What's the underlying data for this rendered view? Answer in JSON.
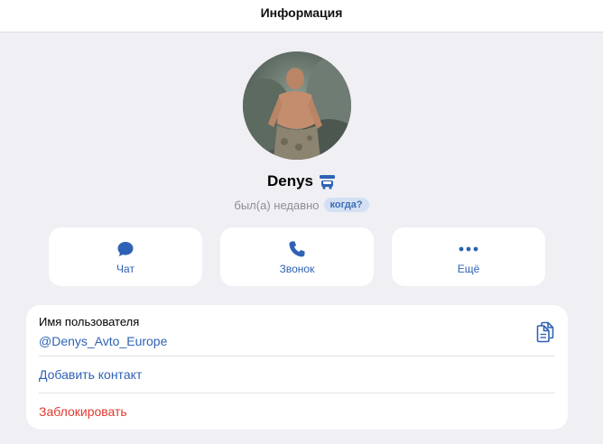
{
  "header": {
    "title": "Информация"
  },
  "profile": {
    "name": "Denys",
    "status": "был(а) недавно",
    "status_badge": "когда?",
    "avatar_icon": "profile-photo",
    "name_badge_icon": "car-emoji-icon"
  },
  "actions": [
    {
      "label": "Чат",
      "icon": "chat-bubble-icon"
    },
    {
      "label": "Звонок",
      "icon": "phone-icon"
    },
    {
      "label": "Ещё",
      "icon": "more-dots-icon"
    }
  ],
  "info": {
    "username_label": "Имя пользователя",
    "username_value": "@Denys_Avto_Europe",
    "copy_icon": "copy-icon",
    "add_contact": "Добавить контакт",
    "block": "Заблокировать"
  },
  "colors": {
    "accent": "#2f62b5",
    "danger": "#e0392f",
    "background": "#efeff4",
    "badge_bg": "#d3e0f3"
  }
}
